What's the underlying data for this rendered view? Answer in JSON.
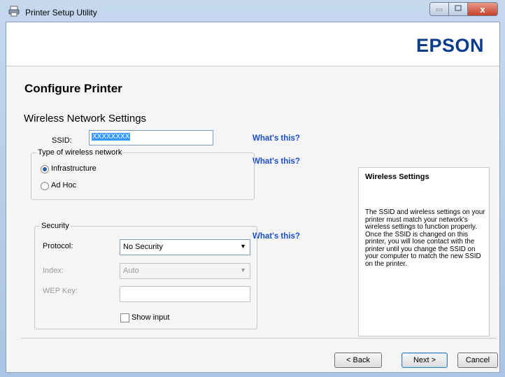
{
  "window": {
    "title": "Printer Setup Utility",
    "close_glyph": "x"
  },
  "header": {
    "logo_text": "EPSON",
    "logo_color": "#0a3c8c"
  },
  "page": {
    "title": "Configure Printer",
    "section_title": "Wireless Network Settings"
  },
  "ssid": {
    "label": "SSID:",
    "value": "XXXXXXXX"
  },
  "help_link": "What's this?",
  "network_type": {
    "legend": "Type of wireless network",
    "options": [
      {
        "label": "Infrastructure",
        "selected": true
      },
      {
        "label": "Ad Hoc",
        "selected": false
      }
    ]
  },
  "security": {
    "legend": "Security",
    "protocol_label": "Protocol:",
    "protocol_value": "No Security",
    "index_label": "Index:",
    "index_value": "Auto",
    "wep_key_label": "WEP Key:",
    "wep_key_value": "",
    "show_input_label": "Show input",
    "show_input_checked": false
  },
  "info_panel": {
    "title": "Wireless Settings",
    "text": "The SSID and wireless settings on your printer must match your network's wireless settings to function properly. Once the SSID is changed on this printer, you will lose contact with the printer until you change the SSID on your computer to match the new SSID on the printer."
  },
  "buttons": {
    "back": "< Back",
    "next": "Next >",
    "cancel": "Cancel"
  },
  "icons": {
    "app": "printer-icon",
    "minimize": "minimize-icon",
    "maximize": "maximize-icon",
    "close": "close-icon",
    "dropdown": "chevron-down-icon"
  },
  "colors": {
    "link": "#1a4ecf",
    "selection": "#3399ff",
    "close_button": "#c8412b"
  }
}
